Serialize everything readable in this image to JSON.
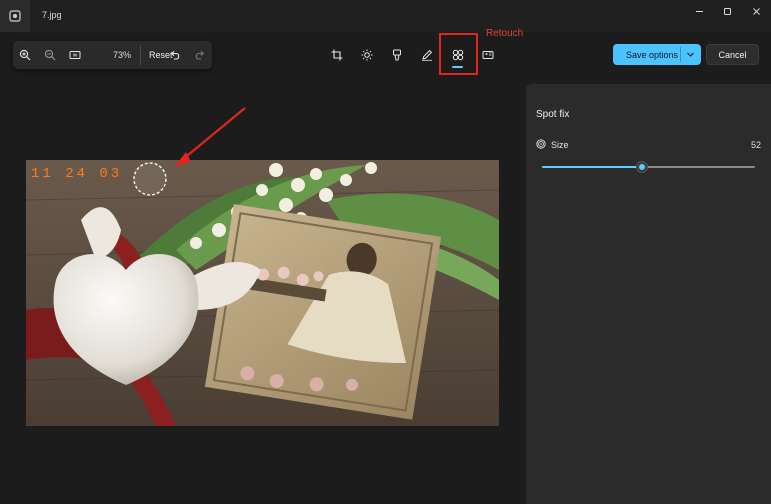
{
  "window": {
    "title": "7.jpg",
    "controls": [
      "minimize",
      "maximize",
      "close"
    ]
  },
  "toolbar": {
    "zoom_value": "73%",
    "reset_label": "Reset",
    "icons": [
      "zoom-in-icon",
      "zoom-out-icon",
      "fit-to-window-icon",
      "undo-icon",
      "redo-icon"
    ],
    "tools": [
      "crop-icon",
      "adjust-icon",
      "filter-icon",
      "markup-icon",
      "retouch-icon",
      "background-icon"
    ],
    "active_tool": "retouch"
  },
  "annotation": {
    "label": "Retouch",
    "color": "#e0261f"
  },
  "actions": {
    "save_label": "Save options",
    "cancel_label": "Cancel"
  },
  "photo": {
    "date_stamp": "11 24 03"
  },
  "panel": {
    "title": "Spot fix",
    "size_label": "Size",
    "size_value": "52",
    "slider_fraction": 0.47
  },
  "colors": {
    "accent": "#60cdff",
    "save_button": "#4cc2ff",
    "background": "#1c1c1c",
    "panel": "#2b2b2b"
  }
}
